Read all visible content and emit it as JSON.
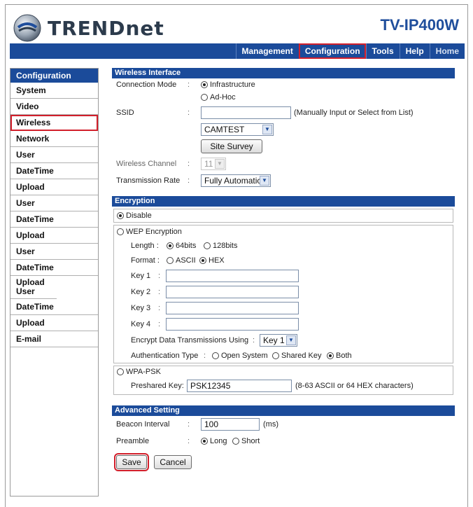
{
  "header": {
    "brand": "TRENDnet",
    "model": "TV-IP400W"
  },
  "topnav": [
    {
      "label": "Management"
    },
    {
      "label": "Configuration"
    },
    {
      "label": "Tools"
    },
    {
      "label": "Help"
    },
    {
      "label": "Home"
    }
  ],
  "sidebar": {
    "title": "Configuration",
    "items": [
      {
        "label": "System"
      },
      {
        "label": "Video"
      },
      {
        "label": "Wireless"
      },
      {
        "label": "Network"
      },
      {
        "label": "User"
      },
      {
        "label": "DateTime"
      },
      {
        "label": "Upload"
      },
      {
        "label": "User"
      },
      {
        "label": "DateTime"
      },
      {
        "label": "Upload"
      },
      {
        "label": "User"
      },
      {
        "label": "DateTime"
      },
      {
        "label": "Upload User"
      },
      {
        "label": "DateTime"
      },
      {
        "label": "Upload"
      },
      {
        "label": "E-mail"
      }
    ]
  },
  "wireless": {
    "title": "Wireless Interface",
    "connection_mode_label": "Connection Mode",
    "colon": ":",
    "infrastructure": "Infrastructure",
    "adhoc": "Ad-Hoc",
    "ssid_label": "SSID",
    "ssid_value": "",
    "ssid_hint": "(Manually Input or Select from List)",
    "ssid_list_value": "CAMTEST",
    "site_survey": "Site Survey",
    "channel_label": "Wireless Channel",
    "channel_value": "11",
    "rate_label": "Transmission Rate",
    "rate_value": "Fully Automatic"
  },
  "encryption": {
    "title": "Encryption",
    "disable": "Disable",
    "wep": "WEP Encryption",
    "length_label": "Length :",
    "len64": "64bits",
    "len128": "128bits",
    "format_label": "Format :",
    "ascii": "ASCII",
    "hex": "HEX",
    "key1": "Key 1",
    "key2": "Key 2",
    "key3": "Key 3",
    "key4": "Key 4",
    "encrypt_using_label": "Encrypt Data Transmissions Using",
    "encrypt_using_value": "Key 1",
    "auth_label": "Authentication Type",
    "open_system": "Open System",
    "shared_key": "Shared Key",
    "both": "Both",
    "wpa": "WPA-PSK",
    "psk_label": "Preshared Key:",
    "psk_value": "PSK12345",
    "psk_hint": "(8-63 ASCII or 64 HEX characters)"
  },
  "advanced": {
    "title": "Advanced Setting",
    "beacon_label": "Beacon Interval",
    "beacon_value": "100",
    "beacon_unit": "(ms)",
    "preamble_label": "Preamble",
    "long": "Long",
    "short": "Short"
  },
  "actions": {
    "save": "Save",
    "cancel": "Cancel"
  },
  "colors": {
    "nav_blue": "#1b4b9a",
    "highlight_red": "#d21f2b"
  }
}
